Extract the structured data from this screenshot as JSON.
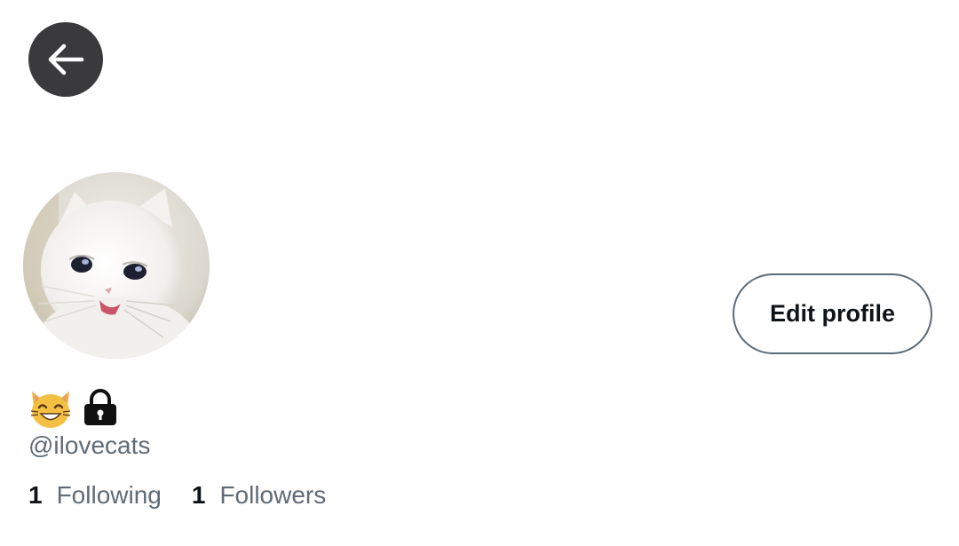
{
  "header": {
    "back_icon": "arrow-left-icon"
  },
  "profile": {
    "avatar_description_icon": "cat-photo-avatar",
    "name_icons": [
      "grinning-cat-emoji",
      "lock-icon"
    ],
    "handle": "@ilovecats",
    "edit_label": "Edit profile",
    "following_count": "1",
    "following_label": "Following",
    "followers_count": "1",
    "followers_label": "Followers"
  },
  "colors": {
    "back_button_bg": "#3a3a3c",
    "secondary_text": "#5f6b77",
    "primary_text": "#0f1419",
    "button_border": "#5b6b78"
  }
}
